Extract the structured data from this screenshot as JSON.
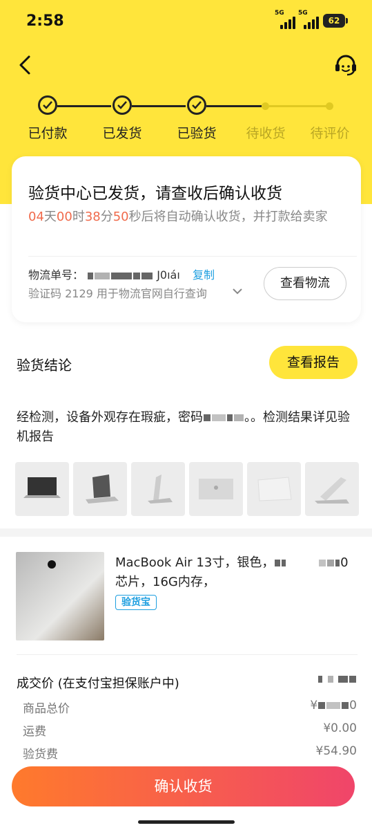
{
  "status_bar": {
    "time": "2:58",
    "sig1": "5G",
    "sig2": "5G",
    "battery": "62"
  },
  "steps": [
    "已付款",
    "已发货",
    "已验货",
    "待收货",
    "待评价"
  ],
  "card": {
    "title": "验货中心已发货，请查收后确认收货",
    "cd_day": "04",
    "cd_day_unit": "天",
    "cd_hour": "00",
    "cd_hour_unit": "时",
    "cd_min": "38",
    "cd_min_unit": "分",
    "cd_sec": "50",
    "cd_tail": "秒后将自动确认收货，并打款给卖家",
    "logistics_label": "物流单号：",
    "logistics_tail": "J0ıáı",
    "copy": "复制",
    "verify_code": "验证码  2129  用于物流官网自行查询",
    "view_logistics": "查看物流"
  },
  "conclusion": {
    "title": "验货结论",
    "report_button": "查看报告",
    "text_a": "经检测，设备外观存在瑕疵，密码",
    "text_b": "。。检测结果详见验机报告"
  },
  "product": {
    "title_a": "MacBook Air 13寸，银色，",
    "title_b": "0",
    "title_line2": "芯片，16G内存，",
    "badge": "验货宝"
  },
  "price": {
    "title": "成交价 (在支付宝担保账户中)",
    "rows": [
      {
        "label": "商品总价",
        "value": "0",
        "prefix": "¥"
      },
      {
        "label": "运费",
        "value": "¥0.00"
      },
      {
        "label": "验货费",
        "value": "¥54.90"
      }
    ]
  },
  "confirm_button": "确认收货",
  "colors": {
    "brand_yellow": "#FFE53B",
    "accent_orange": "#f06a4b",
    "link_blue": "#1e9fe0"
  }
}
